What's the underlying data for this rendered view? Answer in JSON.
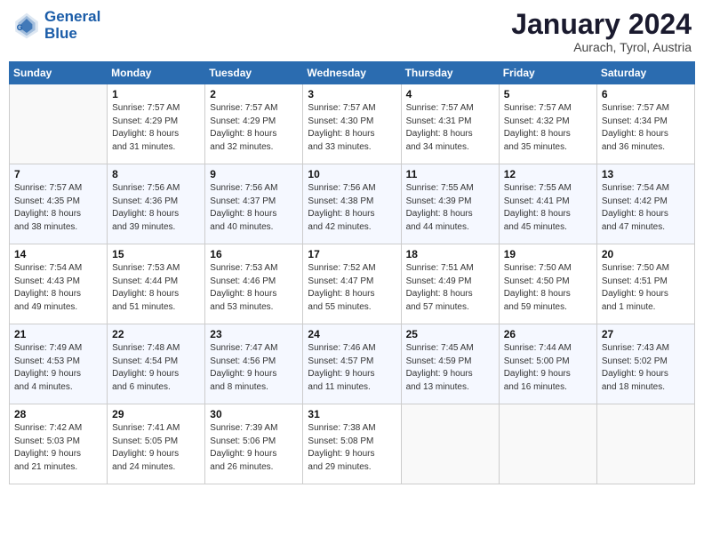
{
  "header": {
    "logo_line1": "General",
    "logo_line2": "Blue",
    "month_year": "January 2024",
    "location": "Aurach, Tyrol, Austria"
  },
  "days_of_week": [
    "Sunday",
    "Monday",
    "Tuesday",
    "Wednesday",
    "Thursday",
    "Friday",
    "Saturday"
  ],
  "weeks": [
    [
      {
        "num": "",
        "info": ""
      },
      {
        "num": "1",
        "info": "Sunrise: 7:57 AM\nSunset: 4:29 PM\nDaylight: 8 hours\nand 31 minutes."
      },
      {
        "num": "2",
        "info": "Sunrise: 7:57 AM\nSunset: 4:29 PM\nDaylight: 8 hours\nand 32 minutes."
      },
      {
        "num": "3",
        "info": "Sunrise: 7:57 AM\nSunset: 4:30 PM\nDaylight: 8 hours\nand 33 minutes."
      },
      {
        "num": "4",
        "info": "Sunrise: 7:57 AM\nSunset: 4:31 PM\nDaylight: 8 hours\nand 34 minutes."
      },
      {
        "num": "5",
        "info": "Sunrise: 7:57 AM\nSunset: 4:32 PM\nDaylight: 8 hours\nand 35 minutes."
      },
      {
        "num": "6",
        "info": "Sunrise: 7:57 AM\nSunset: 4:34 PM\nDaylight: 8 hours\nand 36 minutes."
      }
    ],
    [
      {
        "num": "7",
        "info": "Sunrise: 7:57 AM\nSunset: 4:35 PM\nDaylight: 8 hours\nand 38 minutes."
      },
      {
        "num": "8",
        "info": "Sunrise: 7:56 AM\nSunset: 4:36 PM\nDaylight: 8 hours\nand 39 minutes."
      },
      {
        "num": "9",
        "info": "Sunrise: 7:56 AM\nSunset: 4:37 PM\nDaylight: 8 hours\nand 40 minutes."
      },
      {
        "num": "10",
        "info": "Sunrise: 7:56 AM\nSunset: 4:38 PM\nDaylight: 8 hours\nand 42 minutes."
      },
      {
        "num": "11",
        "info": "Sunrise: 7:55 AM\nSunset: 4:39 PM\nDaylight: 8 hours\nand 44 minutes."
      },
      {
        "num": "12",
        "info": "Sunrise: 7:55 AM\nSunset: 4:41 PM\nDaylight: 8 hours\nand 45 minutes."
      },
      {
        "num": "13",
        "info": "Sunrise: 7:54 AM\nSunset: 4:42 PM\nDaylight: 8 hours\nand 47 minutes."
      }
    ],
    [
      {
        "num": "14",
        "info": "Sunrise: 7:54 AM\nSunset: 4:43 PM\nDaylight: 8 hours\nand 49 minutes."
      },
      {
        "num": "15",
        "info": "Sunrise: 7:53 AM\nSunset: 4:44 PM\nDaylight: 8 hours\nand 51 minutes."
      },
      {
        "num": "16",
        "info": "Sunrise: 7:53 AM\nSunset: 4:46 PM\nDaylight: 8 hours\nand 53 minutes."
      },
      {
        "num": "17",
        "info": "Sunrise: 7:52 AM\nSunset: 4:47 PM\nDaylight: 8 hours\nand 55 minutes."
      },
      {
        "num": "18",
        "info": "Sunrise: 7:51 AM\nSunset: 4:49 PM\nDaylight: 8 hours\nand 57 minutes."
      },
      {
        "num": "19",
        "info": "Sunrise: 7:50 AM\nSunset: 4:50 PM\nDaylight: 8 hours\nand 59 minutes."
      },
      {
        "num": "20",
        "info": "Sunrise: 7:50 AM\nSunset: 4:51 PM\nDaylight: 9 hours\nand 1 minute."
      }
    ],
    [
      {
        "num": "21",
        "info": "Sunrise: 7:49 AM\nSunset: 4:53 PM\nDaylight: 9 hours\nand 4 minutes."
      },
      {
        "num": "22",
        "info": "Sunrise: 7:48 AM\nSunset: 4:54 PM\nDaylight: 9 hours\nand 6 minutes."
      },
      {
        "num": "23",
        "info": "Sunrise: 7:47 AM\nSunset: 4:56 PM\nDaylight: 9 hours\nand 8 minutes."
      },
      {
        "num": "24",
        "info": "Sunrise: 7:46 AM\nSunset: 4:57 PM\nDaylight: 9 hours\nand 11 minutes."
      },
      {
        "num": "25",
        "info": "Sunrise: 7:45 AM\nSunset: 4:59 PM\nDaylight: 9 hours\nand 13 minutes."
      },
      {
        "num": "26",
        "info": "Sunrise: 7:44 AM\nSunset: 5:00 PM\nDaylight: 9 hours\nand 16 minutes."
      },
      {
        "num": "27",
        "info": "Sunrise: 7:43 AM\nSunset: 5:02 PM\nDaylight: 9 hours\nand 18 minutes."
      }
    ],
    [
      {
        "num": "28",
        "info": "Sunrise: 7:42 AM\nSunset: 5:03 PM\nDaylight: 9 hours\nand 21 minutes."
      },
      {
        "num": "29",
        "info": "Sunrise: 7:41 AM\nSunset: 5:05 PM\nDaylight: 9 hours\nand 24 minutes."
      },
      {
        "num": "30",
        "info": "Sunrise: 7:39 AM\nSunset: 5:06 PM\nDaylight: 9 hours\nand 26 minutes."
      },
      {
        "num": "31",
        "info": "Sunrise: 7:38 AM\nSunset: 5:08 PM\nDaylight: 9 hours\nand 29 minutes."
      },
      {
        "num": "",
        "info": ""
      },
      {
        "num": "",
        "info": ""
      },
      {
        "num": "",
        "info": ""
      }
    ]
  ]
}
